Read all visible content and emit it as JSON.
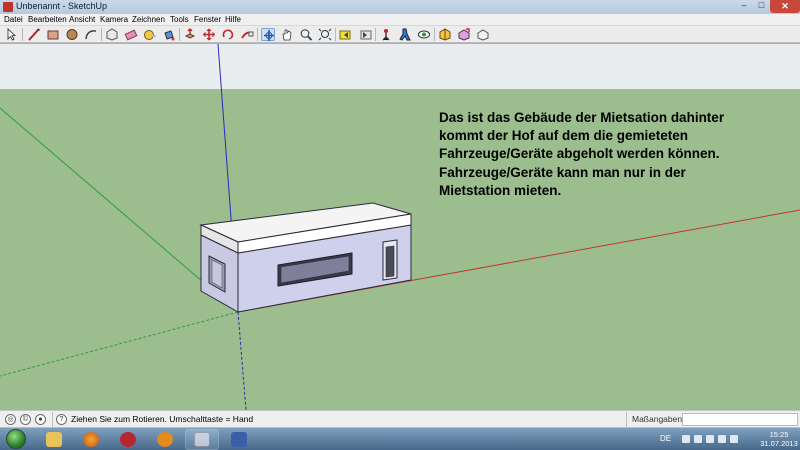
{
  "window": {
    "title": "Unbenannt - SketchUp",
    "close_glyph": "✕",
    "minimize_glyph": "–",
    "maximize_glyph": "□"
  },
  "menu": [
    "Datei",
    "Bearbeiten",
    "Ansicht",
    "Kamera",
    "Zeichnen",
    "Tools",
    "Fenster",
    "Hilfe"
  ],
  "toolbar": {
    "tools": [
      "select",
      "line",
      "rectangle",
      "circle",
      "arc",
      "make-component",
      "eraser",
      "tape-measure",
      "paint-bucket",
      "push-pull",
      "move",
      "rotate",
      "follow-me",
      "offset",
      "orbit",
      "pan",
      "zoom",
      "zoom-extents",
      "previous",
      "next",
      "position-camera",
      "walk",
      "look-around",
      "get-models",
      "share-model",
      "share-component",
      "get-photo-texture"
    ]
  },
  "viewport": {
    "annotation": "Das ist das Gebäude der Mietsation dahinter\nkommt der Hof auf dem die gemieteten\nFahrzeuge/Geräte abgeholt werden können.\nFahrzeuge/Geräte kann man nur in der\nMietstation mieten.",
    "colors": {
      "sky": "#e9edf0",
      "ground": "#9cbd8e",
      "red_axis": "#c0392b",
      "green_axis": "#2e9e3a",
      "blue_axis": "#2b2bbf"
    }
  },
  "statusbar": {
    "hint_text": "Ziehen Sie zum Rotieren.  Umschalttaste = Hand",
    "measure_label": "Maßangaben",
    "measure_value": ""
  },
  "taskbar": {
    "apps": [
      "explorer",
      "firefox",
      "sketchup-bug",
      "media-player",
      "sketchup",
      "paint-app"
    ],
    "language": "DE",
    "time": "15:25",
    "date": "31.07.2013"
  }
}
